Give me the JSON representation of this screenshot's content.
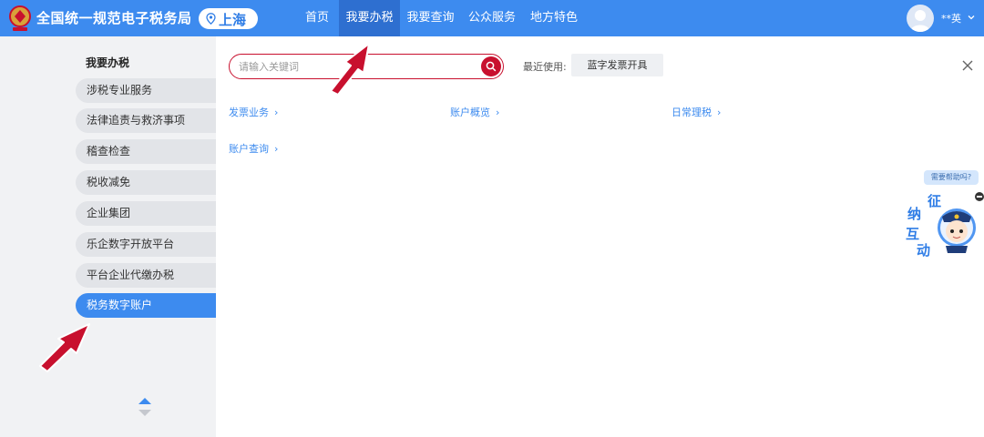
{
  "header": {
    "site_title": "全国统一规范电子税务局",
    "city": "上海",
    "nav": [
      {
        "label": "首页",
        "active": false
      },
      {
        "label": "我要办税",
        "active": true
      },
      {
        "label": "我要查询",
        "active": false
      },
      {
        "label": "公众服务",
        "active": false
      },
      {
        "label": "地方特色",
        "active": false
      }
    ],
    "user_name": "**英"
  },
  "sidebar": {
    "title": "我要办税",
    "items": [
      {
        "label": "涉税专业服务",
        "active": false
      },
      {
        "label": "法律追责与救济事项",
        "active": false
      },
      {
        "label": "稽查检查",
        "active": false
      },
      {
        "label": "税收减免",
        "active": false
      },
      {
        "label": "企业集团",
        "active": false
      },
      {
        "label": "乐企数字开放平台",
        "active": false
      },
      {
        "label": "平台企业代缴办税",
        "active": false
      },
      {
        "label": "税务数字账户",
        "active": true
      }
    ]
  },
  "main": {
    "search_placeholder": "请输入关键词",
    "recent_label": "最近使用:",
    "recent_items": [
      "蓝字发票开具"
    ],
    "categories": [
      {
        "label": "发票业务"
      },
      {
        "label": "账户概览"
      },
      {
        "label": "日常理税"
      },
      {
        "label": "账户查询"
      }
    ],
    "category_chevron": "›"
  },
  "helper": {
    "bubble_text": "需要帮助吗?",
    "chars": [
      "征",
      "纳",
      "互",
      "动"
    ]
  },
  "colors": {
    "header_bg": "#3d8bef",
    "nav_active_bg": "#2e6fd0",
    "accent_red": "#c8102e",
    "link_blue": "#3d8bef",
    "sidebar_bg": "#f1f2f4"
  },
  "icons": {
    "logo": "tax-emblem-icon",
    "city": "location-pin-icon",
    "search": "search-icon",
    "close": "close-icon",
    "user": "user-avatar-icon",
    "caret": "chevron-down-icon",
    "scroll": "scroll-updown-icon"
  }
}
